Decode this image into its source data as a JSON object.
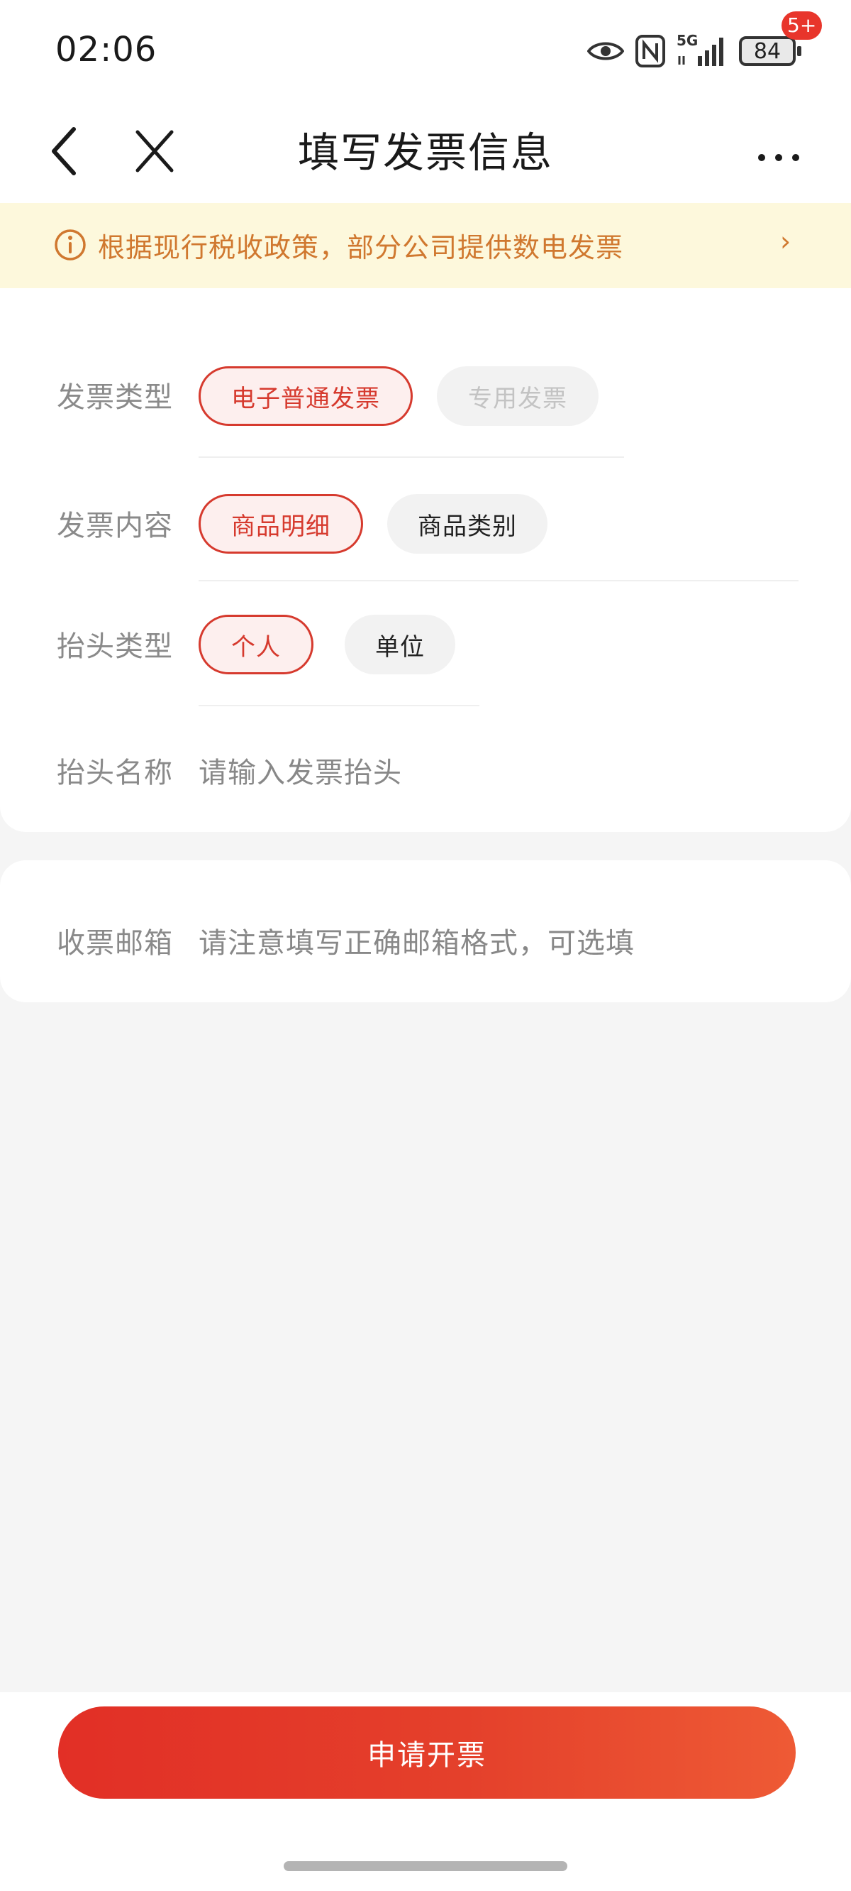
{
  "status_bar": {
    "time": "02:06",
    "network": "5G",
    "battery": "84",
    "icons": [
      "eye-icon",
      "nfc-icon",
      "signal-icon",
      "battery-icon"
    ]
  },
  "navbar": {
    "title": "填写发票信息",
    "badge": "5+",
    "icons": [
      "back-icon",
      "close-icon",
      "more-icon"
    ]
  },
  "notice": {
    "text": "根据现行税收政策，部分公司提供数电发票",
    "arrow": "›",
    "color": "#d0782f",
    "background": "#fdf8dc"
  },
  "form": {
    "invoice_type": {
      "label": "发票类型",
      "options": [
        "电子普通发票",
        "专用发票"
      ],
      "selected": "电子普通发票",
      "disabled": [
        "专用发票"
      ]
    },
    "invoice_content": {
      "label": "发票内容",
      "options": [
        "商品明细",
        "商品类别"
      ],
      "selected": "商品明细"
    },
    "title_type": {
      "label": "抬头类型",
      "options": [
        "个人",
        "单位"
      ],
      "selected": "个人"
    },
    "title_name": {
      "label": "抬头名称",
      "placeholder": "请输入发票抬头",
      "value": ""
    },
    "email": {
      "label": "收票邮箱",
      "placeholder": "请注意填写正确邮箱格式，可选填",
      "value": ""
    }
  },
  "submit": {
    "label": "申请开票",
    "color": "#e22f26"
  },
  "colors": {
    "accent": "#d63a2e",
    "selected_bg": "#fdefee",
    "chip_bg": "#f2f2f2",
    "page_bg": "#f5f5f5"
  }
}
